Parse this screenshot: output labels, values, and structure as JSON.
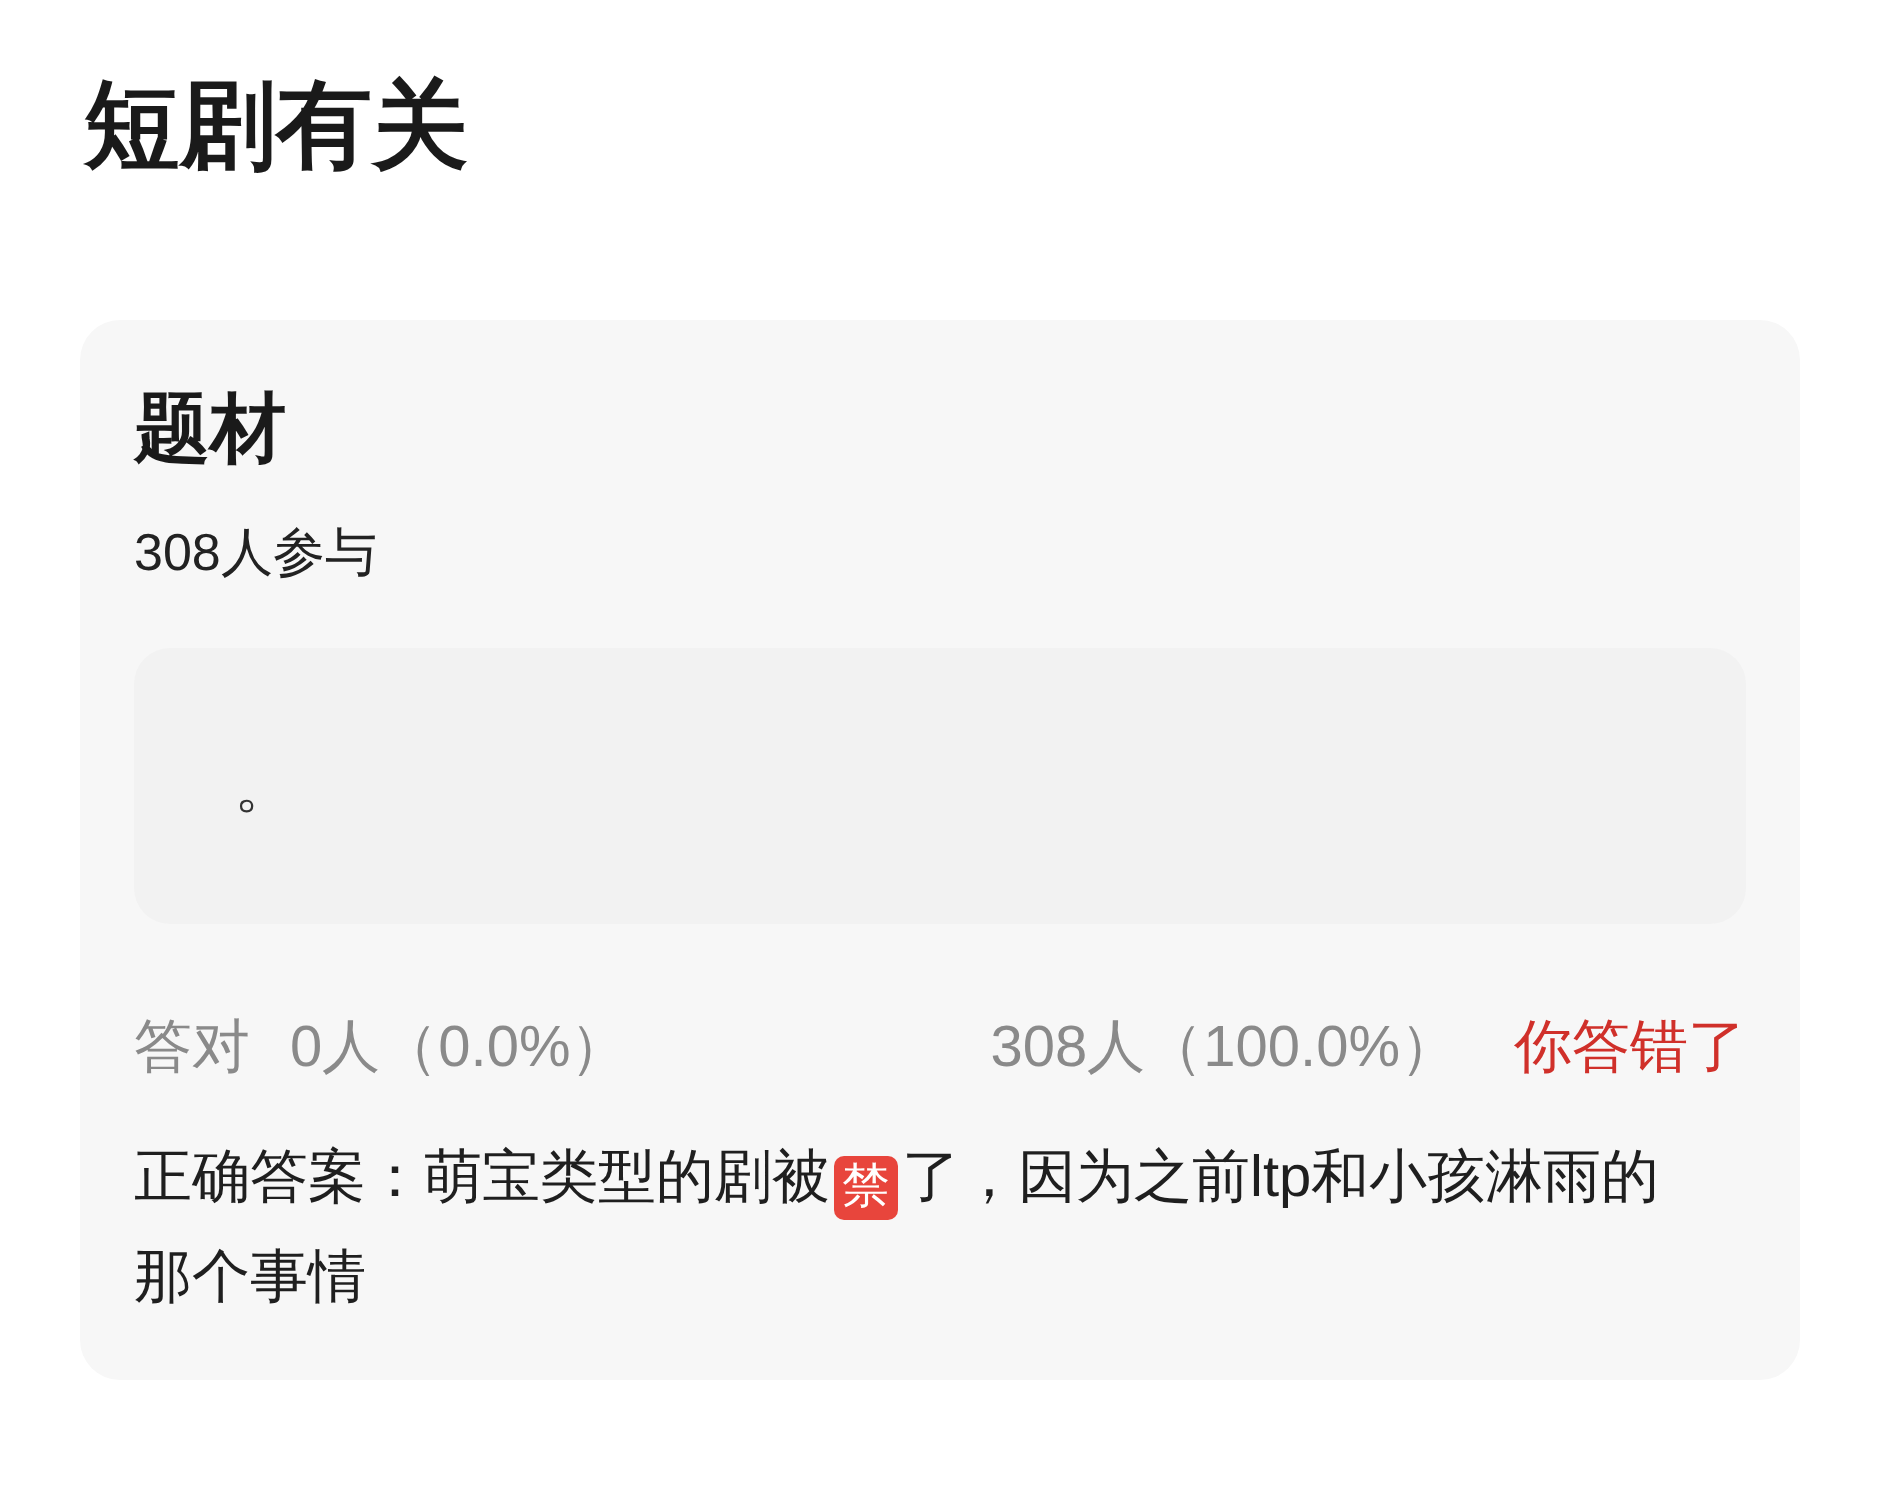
{
  "page_title": "短剧有关",
  "question": {
    "title": "题材",
    "participants": "308人参与",
    "options": [
      {
        "text": "。"
      }
    ],
    "stats": {
      "correct_label": "答对",
      "correct_count": "0人（0.0%）",
      "wrong_count": "308人（100.0%）",
      "result": "你答错了"
    },
    "answer": {
      "before": "正确答案：萌宝类型的剧被",
      "mark": "禁",
      "after": "了，因为之前ltp和小孩淋雨的那个事情"
    }
  }
}
